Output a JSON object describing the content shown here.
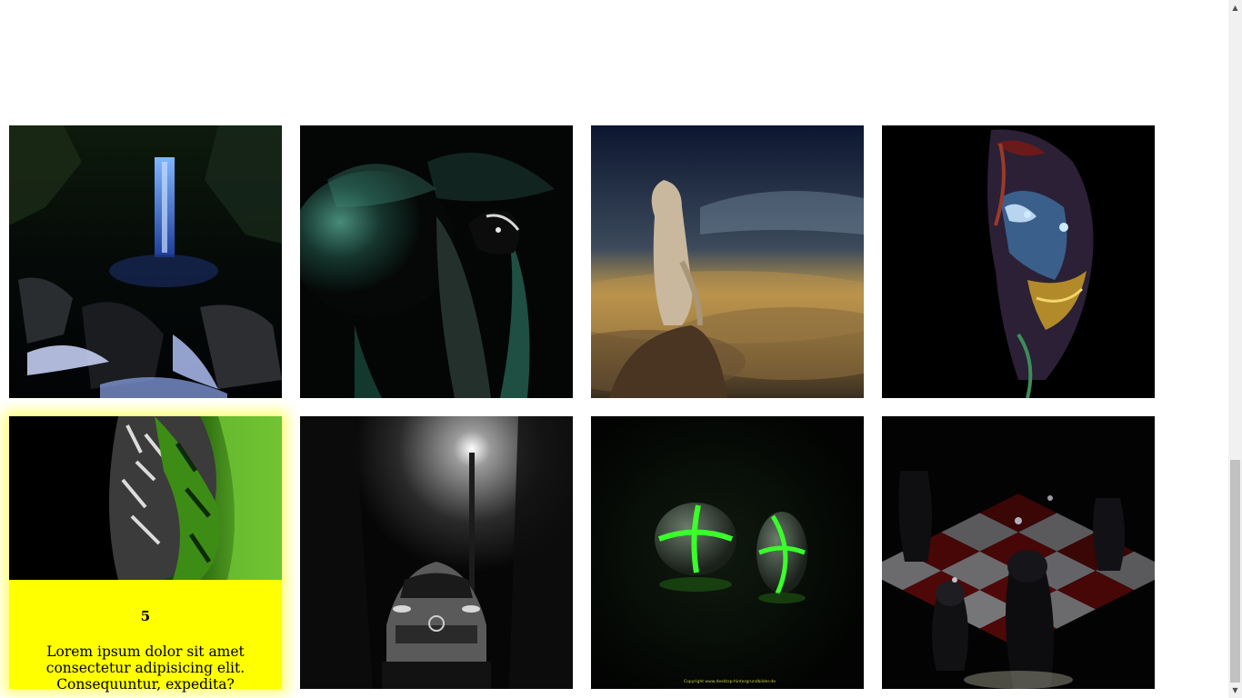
{
  "gallery": {
    "cards": [
      {
        "index": 1,
        "image": "waterfall-night"
      },
      {
        "index": 2,
        "image": "butterfly-leaf"
      },
      {
        "index": 3,
        "image": "person-above-clouds"
      },
      {
        "index": 4,
        "image": "joker-face"
      },
      {
        "index": 5,
        "image": "green-tiger",
        "hover": true,
        "number": "5",
        "text": "Lorem ipsum dolor sit amet consectetur adipisicing elit. Consequuntur, expedita?"
      },
      {
        "index": 6,
        "image": "car-under-streetlight"
      },
      {
        "index": 7,
        "image": "glowing-green-balls",
        "credit": "Copyright www.desktop-hintergrundbilder.de"
      },
      {
        "index": 8,
        "image": "dark-chess-board"
      }
    ]
  },
  "scrollbar": {
    "up_icon": "triangle-up-icon",
    "down_icon": "triangle-down-icon",
    "scroll_fraction": 1.0
  }
}
